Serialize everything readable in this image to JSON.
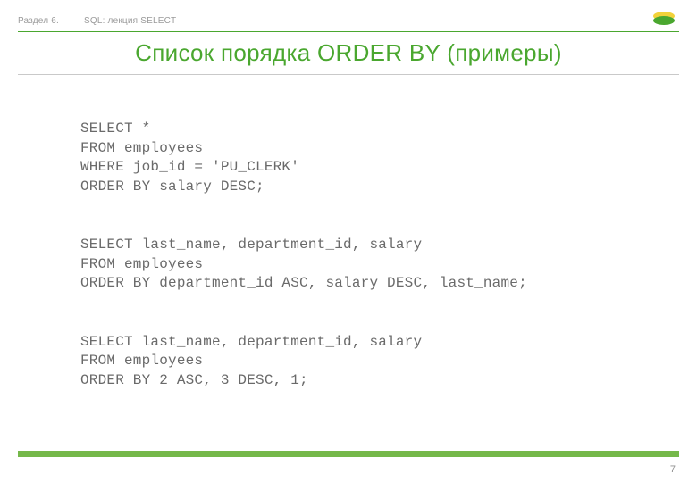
{
  "header": {
    "section_label": "Раздел 6.",
    "lecture_label": "SQL: лекция SELECT"
  },
  "title": "Список порядка ORDER BY (примеры)",
  "code_blocks": [
    "SELECT *\nFROM employees\nWHERE job_id = 'PU_CLERK'\nORDER BY salary DESC;",
    "SELECT last_name, department_id, salary\nFROM employees\nORDER BY department_id ASC, salary DESC, last_name;",
    "SELECT last_name, department_id, salary\nFROM employees\nORDER BY 2 ASC, 3 DESC, 1;"
  ],
  "page_number": "7",
  "colors": {
    "accent": "#4aa72f",
    "footer_bar": "#75b84a"
  }
}
